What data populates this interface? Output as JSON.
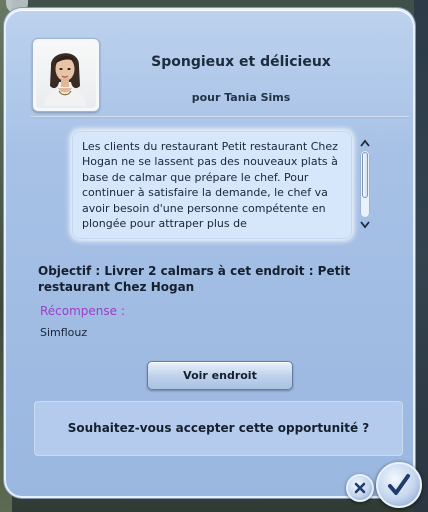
{
  "dialog": {
    "title": "Spongieux et délicieux",
    "subtitle": "pour Tania Sims",
    "description": "Les clients du restaurant Petit restaurant Chez Hogan ne se lassent pas des nouveaux plats à base de calmar que prépare le chef. Pour continuer à satisfaire la demande, le chef va avoir besoin d'une personne compétente en plongée pour attraper plus de",
    "objective": "Objectif : Livrer 2 calmars à cet endroit : Petit restaurant Chez Hogan",
    "reward_label": "Récompense :",
    "reward_value": "Simflouz",
    "view_button_label": "Voir endroit",
    "question": "Souhaitez-vous accepter cette opportunité ?"
  },
  "scrollbar": {
    "position": 0
  },
  "icons": {
    "portrait": "sim-portrait",
    "scroll_up": "chevron-up-icon",
    "scroll_down": "chevron-down-icon",
    "cancel": "x-icon",
    "accept": "check-icon"
  },
  "colors": {
    "dialog_bg": "#a7c1e6",
    "reward_label": "#9b3ec8",
    "text": "#15202e"
  }
}
